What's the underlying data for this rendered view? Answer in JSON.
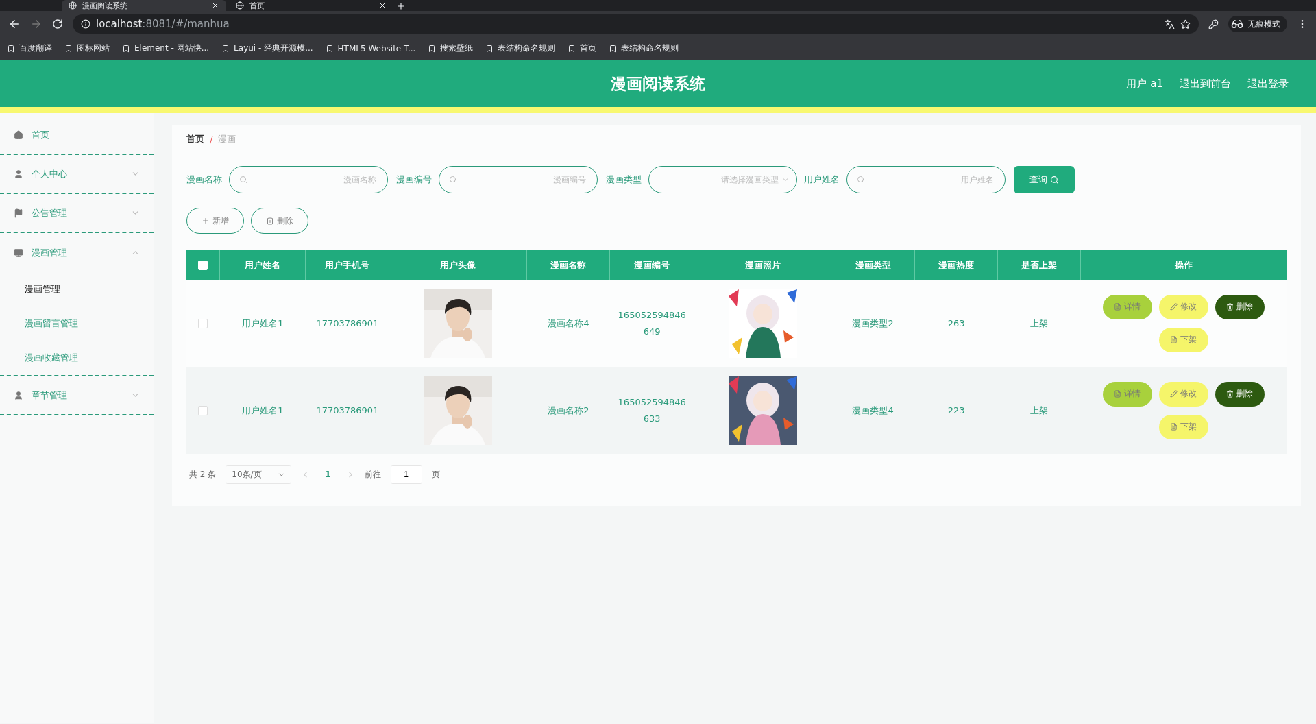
{
  "browser": {
    "tabs": [
      {
        "title": "漫画阅读系统",
        "selected": true
      },
      {
        "title": "首页",
        "selected": false
      }
    ],
    "url_host": "localhost",
    "url_rest": ":8081/#/manhua",
    "profile": "无痕模式",
    "bookmarks": [
      "百度翻译",
      "图标网站",
      "Element - 网站快...",
      "Layui - 经典开源模...",
      "HTML5 Website T...",
      "搜索壁纸",
      "表结构命名规则",
      "首页",
      "表结构命名规则"
    ]
  },
  "header": {
    "title": "漫画阅读系统",
    "links": [
      "用户 a1",
      "退出到前台",
      "退出登录"
    ]
  },
  "sidebar": {
    "items": [
      {
        "label": "首页"
      },
      {
        "label": "个人中心",
        "expanded": false
      },
      {
        "label": "公告管理",
        "expanded": false
      },
      {
        "label": "漫画管理",
        "expanded": true,
        "children": [
          {
            "label": "漫画管理",
            "selected": true
          },
          {
            "label": "漫画留言管理",
            "selected": false
          },
          {
            "label": "漫画收藏管理",
            "selected": false
          }
        ]
      },
      {
        "label": "章节管理",
        "expanded": false
      }
    ]
  },
  "breadcrumb": [
    "首页",
    "漫画"
  ],
  "breadcrumb_separator": "/",
  "filters": [
    {
      "label": "漫画名称",
      "kind": "text",
      "placeholder": "漫画名称"
    },
    {
      "label": "漫画编号",
      "kind": "text",
      "placeholder": "漫画编号"
    },
    {
      "label": "漫画类型",
      "kind": "select",
      "placeholder": "请选择漫画类型"
    },
    {
      "label": "用户姓名",
      "kind": "text",
      "placeholder": "用户姓名"
    }
  ],
  "search_button": "查询",
  "toolbar": [
    {
      "label": "新增",
      "kind": "add"
    },
    {
      "label": "删除",
      "kind": "delete"
    }
  ],
  "table": {
    "select_all": {
      "checked": false
    },
    "columns": [
      "用户姓名",
      "用户手机号",
      "用户头像",
      "漫画名称",
      "漫画编号",
      "漫画照片",
      "漫画类型",
      "漫画热度",
      "是否上架",
      "操作"
    ],
    "rows": [
      {
        "checked": false,
        "user_name": "用户姓名1",
        "phone": "17703786901",
        "comic_name": "漫画名称4",
        "comic_number": "165052594846649",
        "comic_type": "漫画类型2",
        "heat": "263",
        "listed": "上架",
        "actions": [
          {
            "label": "详情",
            "kind": "detail"
          },
          {
            "label": "修改",
            "kind": "edit"
          },
          {
            "label": "删除",
            "kind": "delete"
          },
          {
            "label": "下架",
            "kind": "unlist"
          }
        ]
      },
      {
        "checked": false,
        "user_name": "用户姓名1",
        "phone": "17703786901",
        "comic_name": "漫画名称2",
        "comic_number": "165052594846633",
        "comic_type": "漫画类型4",
        "heat": "223",
        "listed": "上架",
        "actions": [
          {
            "label": "详情",
            "kind": "detail"
          },
          {
            "label": "修改",
            "kind": "edit"
          },
          {
            "label": "删除",
            "kind": "delete"
          },
          {
            "label": "下架",
            "kind": "unlist"
          }
        ]
      }
    ]
  },
  "pagination": {
    "total": "共 2 条",
    "page_size": "10条/页",
    "pages": [
      {
        "label": "1",
        "selected": true
      }
    ],
    "goto_label": "前往",
    "goto_value": "1",
    "goto_suffix": "页"
  }
}
